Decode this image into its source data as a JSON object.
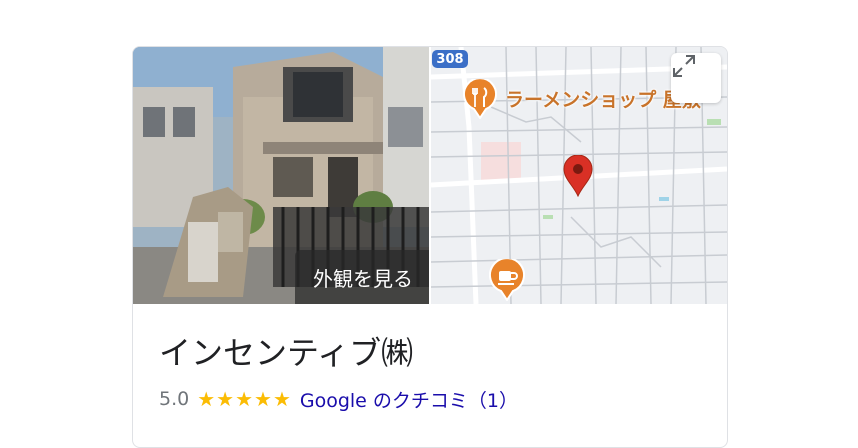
{
  "photo": {
    "street_view_button": "外観を見る"
  },
  "map": {
    "road_number": "308",
    "poi_label": "ラーメンショップ 屋敷",
    "icons": {
      "expand": "expand-icon",
      "restaurant": "fork-knife-icon",
      "cafe": "coffee-cup-icon",
      "pin": "location-pin-icon"
    }
  },
  "business": {
    "name": "インセンティブ㈱",
    "rating": "5.0",
    "stars": "★★★★★",
    "reviews_link": "Google のクチコミ（1）"
  },
  "colors": {
    "stars": "#fbbc04",
    "link": "#1a0dab",
    "pin": "#d93025",
    "poi": "#e8832a",
    "road_shield": "#3b6fc7"
  }
}
